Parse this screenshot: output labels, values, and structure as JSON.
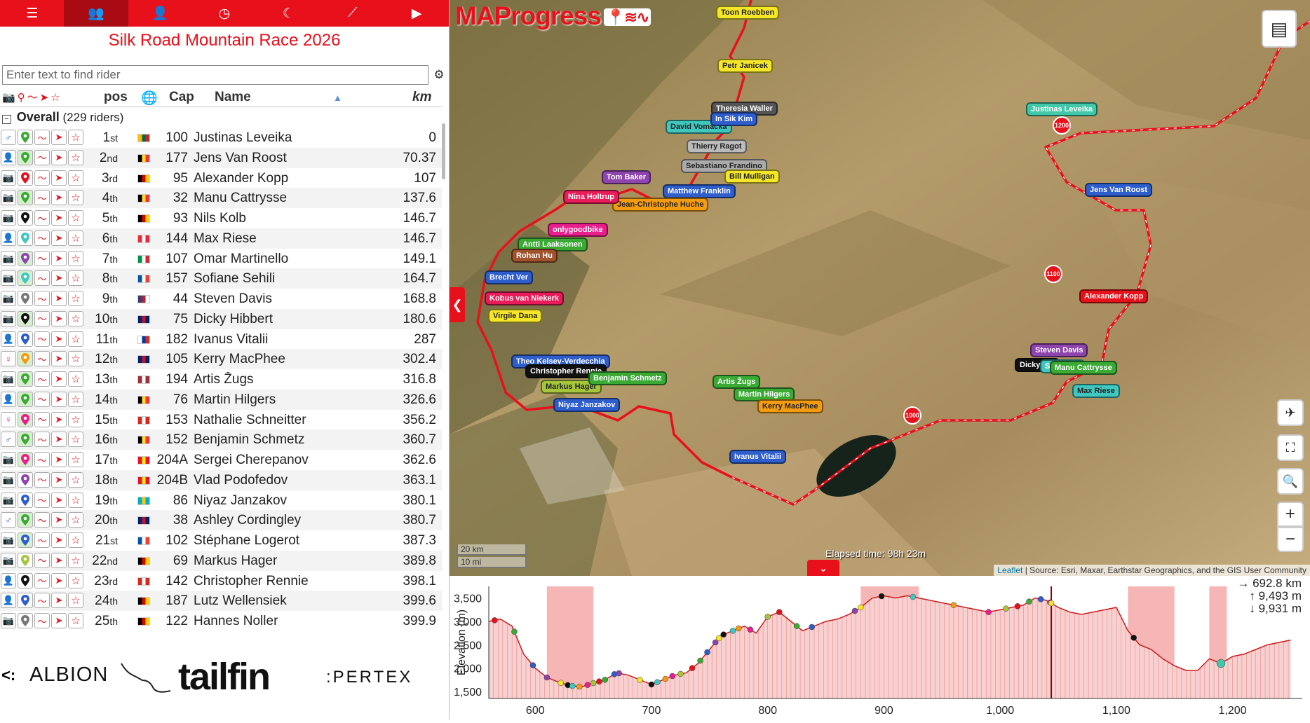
{
  "topbar": {
    "tabs": [
      {
        "name": "menu-icon",
        "glyph": "☰"
      },
      {
        "name": "group-icon",
        "glyph": "👥",
        "active": true
      },
      {
        "name": "person-icon",
        "glyph": "👤"
      },
      {
        "name": "clock-icon",
        "glyph": "◷"
      },
      {
        "name": "moon-icon",
        "glyph": "☾"
      },
      {
        "name": "chart-line-icon",
        "glyph": "⟋"
      },
      {
        "name": "play-icon",
        "glyph": "▶"
      }
    ]
  },
  "race": {
    "title": "Silk Road Mountain Race 2026"
  },
  "search": {
    "placeholder": "Enter text to find rider"
  },
  "table": {
    "headers": {
      "pos": "pos",
      "cap": "Cap",
      "name": "Name",
      "km": "km"
    },
    "group": {
      "label": "Overall",
      "count": "(229 riders)"
    },
    "rows": [
      {
        "pos": "1",
        "sfx": "st",
        "cap": "100",
        "name": "Justinas Leveika",
        "km": "0",
        "flag": [
          "#fdb913",
          "#006a44",
          "#c1272d"
        ],
        "g": "male",
        "pin": "#3aaa35"
      },
      {
        "pos": "2",
        "sfx": "nd",
        "cap": "177",
        "name": "Jens Van Roost",
        "km": "70.37",
        "flag": [
          "#000",
          "#fdda24",
          "#ef3340"
        ],
        "g": "person",
        "pin": "#3aaa35",
        "v": 1
      },
      {
        "pos": "3",
        "sfx": "rd",
        "cap": "95",
        "name": "Alexander Kopp",
        "km": "107",
        "flag": [
          "#000",
          "#dd0000",
          "#ffce00"
        ],
        "g": "camera",
        "pin": "#e8111b"
      },
      {
        "pos": "4",
        "sfx": "th",
        "cap": "32",
        "name": "Manu Cattrysse",
        "km": "137.6",
        "flag": [
          "#000",
          "#fdda24",
          "#ef3340"
        ],
        "g": "camera",
        "pin": "#3aaa35",
        "v": 1
      },
      {
        "pos": "5",
        "sfx": "th",
        "cap": "93",
        "name": "Nils Kolb",
        "km": "146.7",
        "flag": [
          "#000",
          "#dd0000",
          "#ffce00"
        ],
        "g": "camera",
        "pin": "#111"
      },
      {
        "pos": "6",
        "sfx": "th",
        "cap": "144",
        "name": "Max Riese",
        "km": "146.7",
        "flag": [
          "#ed2939",
          "#fff",
          "#ed2939"
        ],
        "g": "person",
        "pin": "#40c8c0"
      },
      {
        "pos": "7",
        "sfx": "th",
        "cap": "107",
        "name": "Omar Martinello",
        "km": "149.1",
        "flag": [
          "#009246",
          "#fff",
          "#ce2b37"
        ],
        "g": "camera",
        "pin": "#8e44ad",
        "v": 1
      },
      {
        "pos": "8",
        "sfx": "th",
        "cap": "157",
        "name": "Sofiane Sehili",
        "km": "164.7",
        "flag": [
          "#0055a4",
          "#fff",
          "#ef4135"
        ],
        "g": "camera",
        "pin": "#40c8c0",
        "v": 1
      },
      {
        "pos": "9",
        "sfx": "th",
        "cap": "44",
        "name": "Steven Davis",
        "km": "168.8",
        "flag": [
          "#3c3b6e",
          "#b22234",
          "#fff"
        ],
        "g": "camera",
        "pin": "#777"
      },
      {
        "pos": "10",
        "sfx": "th",
        "cap": "75",
        "name": "Dicky Hibbert",
        "km": "180.6",
        "flag": [
          "#012169",
          "#c8102e",
          "#012169"
        ],
        "g": "camera",
        "pin": "#111",
        "v": 1
      },
      {
        "pos": "11",
        "sfx": "th",
        "cap": "182",
        "name": "Ivanus Vitalii",
        "km": "287",
        "flag": [
          "#fff",
          "#0039a6",
          "#d52b1e"
        ],
        "g": "person",
        "pin": "#2e5dcc"
      },
      {
        "pos": "12",
        "sfx": "th",
        "cap": "105",
        "name": "Kerry MacPhee",
        "km": "302.4",
        "flag": [
          "#012169",
          "#c8102e",
          "#012169"
        ],
        "g": "female",
        "pin": "#f39c12",
        "v": 1
      },
      {
        "pos": "13",
        "sfx": "th",
        "cap": "194",
        "name": "Artis Žugs",
        "km": "316.8",
        "flag": [
          "#9e3039",
          "#fff",
          "#9e3039"
        ],
        "g": "camera",
        "pin": "#3aaa35",
        "v": 1
      },
      {
        "pos": "14",
        "sfx": "th",
        "cap": "76",
        "name": "Martin Hilgers",
        "km": "326.6",
        "flag": [
          "#000",
          "#fdda24",
          "#ef3340"
        ],
        "g": "person",
        "pin": "#3aaa35",
        "v": 1
      },
      {
        "pos": "15",
        "sfx": "th",
        "cap": "153",
        "name": "Nathalie Schneitter",
        "km": "356.2",
        "flag": [
          "#d52b1e",
          "#fff",
          "#d52b1e"
        ],
        "g": "female",
        "pin": "#e91e8c",
        "v": 1
      },
      {
        "pos": "16",
        "sfx": "th",
        "cap": "152",
        "name": "Benjamin Schmetz",
        "km": "360.7",
        "flag": [
          "#000",
          "#fdda24",
          "#ef3340"
        ],
        "g": "male",
        "pin": "#3aaa35",
        "v": 1
      },
      {
        "pos": "17",
        "sfx": "th",
        "cap": "204A",
        "name": "Sergei Cherepanov",
        "km": "362.6",
        "flag": [
          "#e8112d",
          "#ffef00",
          "#e8112d"
        ],
        "g": "camera",
        "pin": "#e91e8c",
        "v": 1
      },
      {
        "pos": "18",
        "sfx": "th",
        "cap": "204B",
        "name": "Vlad Podofedov",
        "km": "363.1",
        "flag": [
          "#e8112d",
          "#ffef00",
          "#e8112d"
        ],
        "g": "camera",
        "pin": "#8e44ad"
      },
      {
        "pos": "19",
        "sfx": "th",
        "cap": "86",
        "name": "Niyaz Janzakov",
        "km": "380.1",
        "flag": [
          "#00afca",
          "#fec50c",
          "#00afca"
        ],
        "g": "camera",
        "pin": "#2e5dcc"
      },
      {
        "pos": "20",
        "sfx": "th",
        "cap": "38",
        "name": "Ashley Cordingley",
        "km": "380.7",
        "flag": [
          "#012169",
          "#c8102e",
          "#012169"
        ],
        "g": "male",
        "pin": "#3aaa35",
        "v": 1
      },
      {
        "pos": "21",
        "sfx": "st",
        "cap": "102",
        "name": "Stéphane Logerot",
        "km": "387.3",
        "flag": [
          "#0055a4",
          "#fff",
          "#ef4135"
        ],
        "g": "camera",
        "pin": "#2e5dcc",
        "v": 1
      },
      {
        "pos": "22",
        "sfx": "nd",
        "cap": "69",
        "name": "Markus Hager",
        "km": "389.8",
        "flag": [
          "#000",
          "#dd0000",
          "#ffce00"
        ],
        "g": "camera",
        "pin": "#a5c63b"
      },
      {
        "pos": "23",
        "sfx": "rd",
        "cap": "142",
        "name": "Christopher Rennie",
        "km": "398.1",
        "flag": [
          "#d52b1e",
          "#fff",
          "#d52b1e"
        ],
        "g": "person",
        "pin": "#111"
      },
      {
        "pos": "24",
        "sfx": "th",
        "cap": "187",
        "name": "Lutz Wellensiek",
        "km": "399.6",
        "flag": [
          "#000",
          "#dd0000",
          "#ffce00"
        ],
        "g": "person",
        "pin": "#2e5dcc"
      },
      {
        "pos": "25",
        "sfx": "th",
        "cap": "122",
        "name": "Hannes Noller",
        "km": "399.9",
        "flag": [
          "#000",
          "#dd0000",
          "#ffce00"
        ],
        "g": "camera",
        "pin": "#777"
      }
    ]
  },
  "sponsors": {
    "s1": "ALBION",
    "s2": "tailfin",
    "s3": ":PERTEX"
  },
  "map": {
    "logo": "MAProgress",
    "elapsed": "Elapsed time: 98h 23m",
    "scale_km": "20 km",
    "scale_mi": "10 mi",
    "attribution_link": "Leaflet",
    "attribution_text": "| Source: Esri, Maxar, Earthstar Geographics, and the GIS User Community",
    "km_markers": [
      "1200",
      "1100",
      "1000"
    ],
    "labels": [
      {
        "t": "Toon Roebben",
        "c": "#f5e62a",
        "fg": "#222"
      },
      {
        "t": "Petr Janicek",
        "c": "#f5e62a",
        "fg": "#222"
      },
      {
        "t": "Justinas Leveika",
        "c": "#40c8a8",
        "fg": "#fff"
      },
      {
        "t": "Theresia Waller",
        "c": "#555",
        "fg": "#fff"
      },
      {
        "t": "David Vomacka",
        "c": "#40c8c0",
        "fg": "#222"
      },
      {
        "t": "In Sik Kim",
        "c": "#2e5dcc",
        "fg": "#fff"
      },
      {
        "t": "Thierry Ragot",
        "c": "#bbb",
        "fg": "#222"
      },
      {
        "t": "Sebastiano Frandino",
        "c": "#aaa",
        "fg": "#222"
      },
      {
        "t": "Bill Mulligan",
        "c": "#f5e62a",
        "fg": "#222"
      },
      {
        "t": "Tom Baker",
        "c": "#8e44ad",
        "fg": "#fff"
      },
      {
        "t": "Matthew Franklin",
        "c": "#2e5dcc",
        "fg": "#fff"
      },
      {
        "t": "Jean-Christophe Huche",
        "c": "#f39c12",
        "fg": "#222"
      },
      {
        "t": "Nina Holtrup",
        "c": "#e81c5a",
        "fg": "#fff"
      },
      {
        "t": "Jens Van Roost",
        "c": "#2e5dcc",
        "fg": "#fff"
      },
      {
        "t": "onlygoodbike",
        "c": "#e91e8c",
        "fg": "#fff"
      },
      {
        "t": "Antti Laaksonen",
        "c": "#3aaa35",
        "fg": "#fff"
      },
      {
        "t": "Rohan Hu",
        "c": "#a0522d",
        "fg": "#fff"
      },
      {
        "t": "Brecht Ver",
        "c": "#2e5dcc",
        "fg": "#fff"
      },
      {
        "t": "Kobus van Niekerk",
        "c": "#e81c5a",
        "fg": "#fff"
      },
      {
        "t": "Virgile Dana",
        "c": "#f5e62a",
        "fg": "#222"
      },
      {
        "t": "Alexander Kopp",
        "c": "#e8111b",
        "fg": "#fff"
      },
      {
        "t": "Steven Davis",
        "c": "#8e44ad",
        "fg": "#fff"
      },
      {
        "t": "Dicky Hib",
        "c": "#111",
        "fg": "#fff"
      },
      {
        "t": "Sofiane S",
        "c": "#40c8c0",
        "fg": "#fff"
      },
      {
        "t": "Manu Cattrysse",
        "c": "#3aaa35",
        "fg": "#fff"
      },
      {
        "t": "Max Riese",
        "c": "#40c8c0",
        "fg": "#222"
      },
      {
        "t": "Theo Kelsey-Verdecchia",
        "c": "#2e5dcc",
        "fg": "#fff"
      },
      {
        "t": "Christopher Rennie",
        "c": "#111",
        "fg": "#fff"
      },
      {
        "t": "Markus Hager",
        "c": "#a5c63b",
        "fg": "#222"
      },
      {
        "t": "Benjamin Schmetz",
        "c": "#3aaa35",
        "fg": "#fff"
      },
      {
        "t": "Niyaz Janzakov",
        "c": "#2e5dcc",
        "fg": "#fff"
      },
      {
        "t": "Artis Žugs",
        "c": "#3aaa35",
        "fg": "#fff"
      },
      {
        "t": "Martin Hilgers",
        "c": "#3aaa35",
        "fg": "#fff"
      },
      {
        "t": "Kerry MacPhee",
        "c": "#f39c12",
        "fg": "#222"
      },
      {
        "t": "Ivanus Vitalii",
        "c": "#2e5dcc",
        "fg": "#fff"
      }
    ]
  },
  "elevation": {
    "distance": "→ 692.8 km",
    "ascent": "↑ 9,493 m",
    "descent": "↓ 9,931 m",
    "ylabel": "Elevation (m)",
    "y_ticks": [
      "3,500",
      "3,000",
      "2,500",
      "2,000",
      "1,500"
    ],
    "x_ticks": [
      "600",
      "700",
      "800",
      "900",
      "1,000",
      "1,100",
      "1,200"
    ],
    "profile": [
      [
        560,
        3000
      ],
      [
        570,
        3050
      ],
      [
        580,
        2900
      ],
      [
        590,
        2300
      ],
      [
        600,
        2000
      ],
      [
        610,
        1800
      ],
      [
        620,
        1700
      ],
      [
        630,
        1620
      ],
      [
        640,
        1600
      ],
      [
        650,
        1680
      ],
      [
        660,
        1750
      ],
      [
        670,
        1900
      ],
      [
        680,
        1850
      ],
      [
        690,
        1750
      ],
      [
        700,
        1650
      ],
      [
        710,
        1750
      ],
      [
        720,
        1850
      ],
      [
        730,
        1900
      ],
      [
        740,
        2100
      ],
      [
        750,
        2400
      ],
      [
        760,
        2700
      ],
      [
        770,
        2800
      ],
      [
        780,
        2900
      ],
      [
        790,
        2750
      ],
      [
        800,
        3100
      ],
      [
        810,
        3200
      ],
      [
        820,
        3000
      ],
      [
        830,
        2800
      ],
      [
        840,
        2900
      ],
      [
        850,
        3000
      ],
      [
        860,
        3050
      ],
      [
        870,
        3150
      ],
      [
        880,
        3300
      ],
      [
        890,
        3500
      ],
      [
        900,
        3550
      ],
      [
        910,
        3500
      ],
      [
        920,
        3550
      ],
      [
        930,
        3500
      ],
      [
        940,
        3450
      ],
      [
        950,
        3400
      ],
      [
        960,
        3350
      ],
      [
        970,
        3300
      ],
      [
        980,
        3250
      ],
      [
        990,
        3200
      ],
      [
        1000,
        3250
      ],
      [
        1010,
        3300
      ],
      [
        1020,
        3350
      ],
      [
        1030,
        3500
      ],
      [
        1040,
        3450
      ],
      [
        1050,
        3300
      ],
      [
        1060,
        3200
      ],
      [
        1070,
        3150
      ],
      [
        1080,
        3200
      ],
      [
        1090,
        3250
      ],
      [
        1100,
        3300
      ],
      [
        1110,
        2800
      ],
      [
        1120,
        2500
      ],
      [
        1130,
        2400
      ],
      [
        1140,
        2200
      ],
      [
        1150,
        2050
      ],
      [
        1160,
        1950
      ],
      [
        1170,
        1950
      ],
      [
        1180,
        2200
      ],
      [
        1190,
        2100
      ],
      [
        1200,
        2250
      ],
      [
        1210,
        2300
      ],
      [
        1220,
        2400
      ],
      [
        1230,
        2500
      ],
      [
        1240,
        2550
      ],
      [
        1250,
        2600
      ]
    ]
  },
  "colors": {
    "brand": "#e8111b",
    "dark": "#a80b12"
  }
}
